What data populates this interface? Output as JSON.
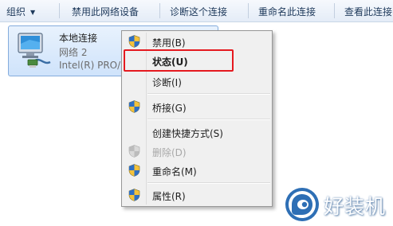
{
  "toolbar": {
    "organize": "组织",
    "disable_device": "禁用此网络设备",
    "diagnose_connection": "诊断这个连接",
    "rename_connection": "重命名此连接",
    "view_status": "查看此连接"
  },
  "adapter": {
    "name": "本地连接",
    "network": "网络  2",
    "device": "Intel(R) PRO/"
  },
  "context_menu": {
    "items": [
      {
        "label": "禁用(B)",
        "icon": "uac-shield-icon",
        "enabled": true,
        "default": false
      },
      {
        "label": "状态(U)",
        "icon": null,
        "enabled": true,
        "default": true
      },
      {
        "label": "诊断(I)",
        "icon": null,
        "enabled": true,
        "default": false
      },
      {
        "label": "桥接(G)",
        "icon": "uac-shield-icon",
        "enabled": true,
        "default": false
      },
      {
        "label": "创建快捷方式(S)",
        "icon": null,
        "enabled": true,
        "default": false
      },
      {
        "label": "删除(D)",
        "icon": "uac-shield-icon",
        "enabled": false,
        "default": false
      },
      {
        "label": "重命名(M)",
        "icon": "uac-shield-icon",
        "enabled": true,
        "default": false
      },
      {
        "label": "属性(R)",
        "icon": "uac-shield-icon",
        "enabled": true,
        "default": false
      }
    ]
  },
  "colors": {
    "highlight_border": "#e5191f",
    "selection_bg": "#cfe3fb",
    "toolbar_text": "#1e395b"
  },
  "watermark": {
    "text": "好装机"
  }
}
